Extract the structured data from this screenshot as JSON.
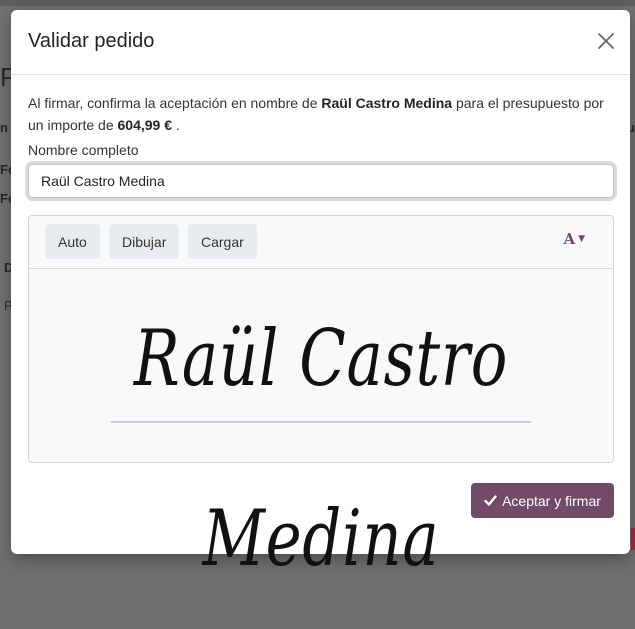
{
  "background": {
    "fragments": [
      "P",
      "n",
      "Fe",
      "Fe",
      "D",
      "P",
      "u"
    ]
  },
  "modal": {
    "title": "Validar pedido",
    "confirm_prefix": "Al firmar, confirma la aceptación en nombre de",
    "signer_name": "Raül Castro Medina",
    "confirm_middle": "para el presupuesto por un importe de",
    "amount": "604,99 €",
    "confirm_suffix": ".",
    "name_label": "Nombre completo",
    "name_value": "Raül Castro Medina",
    "signature_modes": [
      "Auto",
      "Dibujar",
      "Cargar"
    ],
    "font_selector_label": "A",
    "signature_text": "Raül Castro Medina",
    "accept_label": "Aceptar y firmar"
  },
  "colors": {
    "primary": "#714b67",
    "danger_accent": "#b3263c"
  },
  "icons": {
    "close": "close-icon",
    "accept": "check-icon",
    "font": "font-icon"
  }
}
